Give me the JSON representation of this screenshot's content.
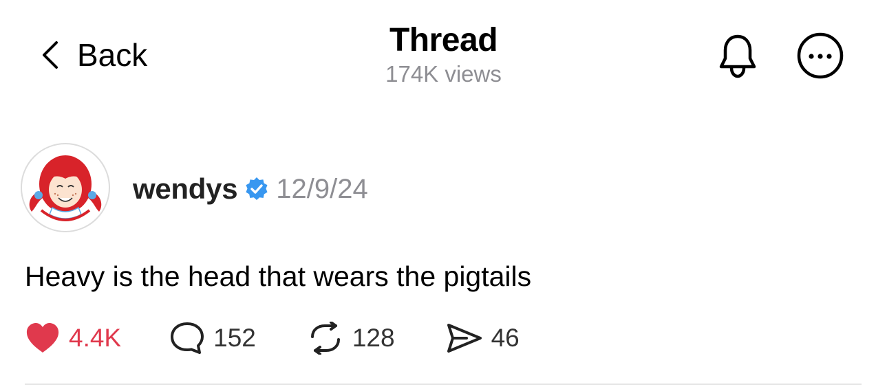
{
  "header": {
    "back_label": "Back",
    "title": "Thread",
    "views": "174K views",
    "back_icon": "chevron-left-icon",
    "bell_icon": "bell-icon",
    "more_icon": "more-circle-icon"
  },
  "post": {
    "username": "wendys",
    "verified": true,
    "date": "12/9/24",
    "text": "Heavy is the head that wears the pigtails",
    "avatar_brand": "Wendy's",
    "stats": {
      "likes": "4.4K",
      "replies": "152",
      "reposts": "128",
      "shares": "46"
    }
  },
  "colors": {
    "like": "#e0394d",
    "verified": "#3897f0",
    "muted": "#8e8e93"
  }
}
